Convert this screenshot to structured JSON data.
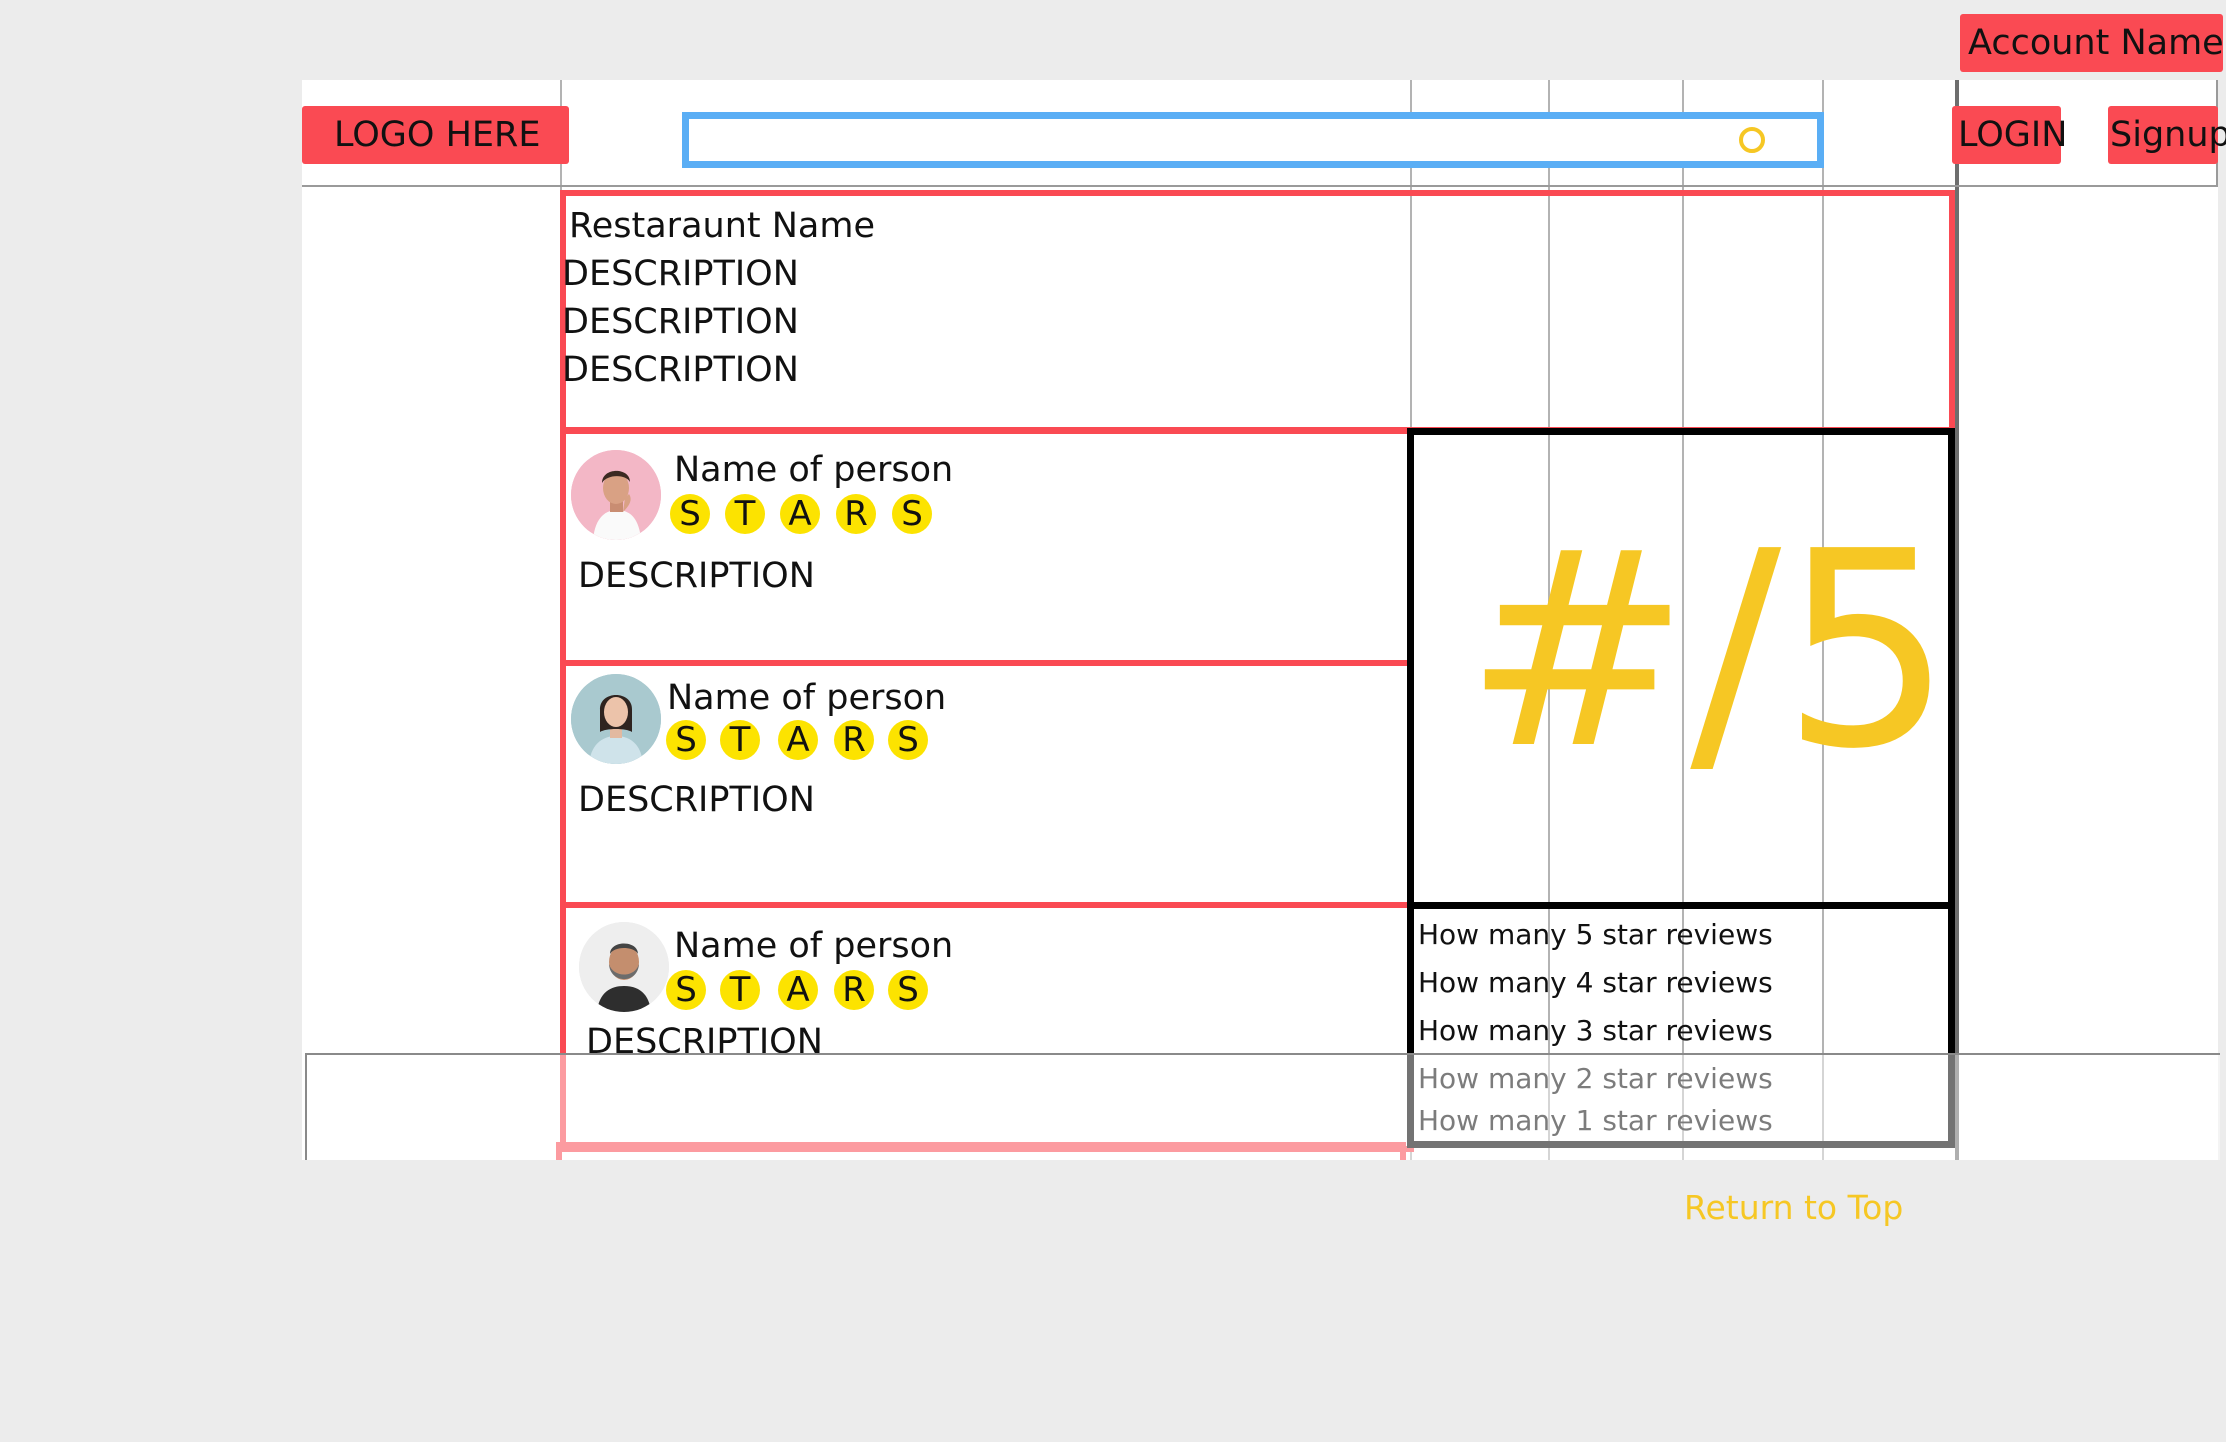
{
  "header": {
    "account_name": "Account Name",
    "logo": "LOGO HERE",
    "login": "LOGIN",
    "signup": "Signup",
    "search_placeholder": "",
    "search_icon": "search-icon"
  },
  "restaurant": {
    "name": "Restaraunt Name",
    "description_lines": [
      "DESCRIPTION",
      "DESCRIPTION",
      "DESCRIPTION"
    ]
  },
  "reviews": [
    {
      "name": "Name of person",
      "stars": [
        "S",
        "T",
        "A",
        "R",
        "S"
      ],
      "description": "DESCRIPTION",
      "avatar": "man-pink-shirt"
    },
    {
      "name": "Name of person",
      "stars": [
        "S",
        "T",
        "A",
        "R",
        "S"
      ],
      "description": "DESCRIPTION",
      "avatar": "woman-light-blue"
    },
    {
      "name": "Name of person",
      "stars": [
        "S",
        "T",
        "A",
        "R",
        "S"
      ],
      "description": "DESCRIPTION",
      "avatar": "bearded-man"
    }
  ],
  "rating": {
    "score_text": "#/5",
    "breakdown": [
      "How many 5 star reviews",
      "How many 4 star reviews",
      "How many 3 star reviews",
      "How many 2 star reviews",
      "How many 1 star reviews"
    ]
  },
  "footer": {
    "return_to_top": "Return to Top"
  },
  "colors": {
    "accent_red": "#fa4a53",
    "star_yellow": "#fce300",
    "score_yellow": "#f6c724",
    "search_blue": "#5aaef5",
    "background": "#ececec"
  }
}
